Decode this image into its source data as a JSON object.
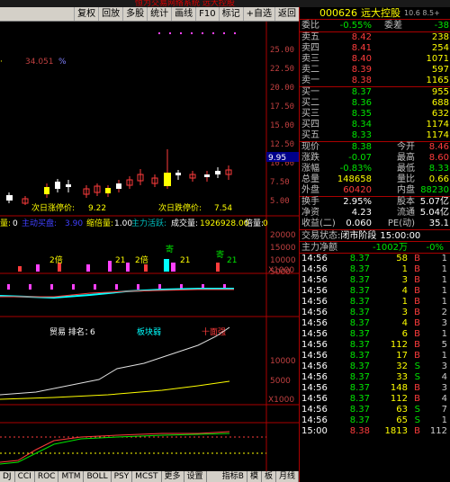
{
  "window_title": "恒为交易网络系统  远大控股",
  "toolbar": {
    "items": [
      "复权",
      "回放",
      "多股",
      "统计",
      "画线",
      "F10",
      "标记",
      "+自选",
      "返回"
    ]
  },
  "stock": {
    "code": "000626",
    "name": "远大控股"
  },
  "top_right_label": "10.6 8.5+",
  "axis_price": [
    "25.00",
    "22.50",
    "20.00",
    "17.50",
    "15.00",
    "12.50",
    "10.00",
    "7.50",
    "5.00"
  ],
  "current_price_tag": "9.95",
  "left_label_1": "34.051",
  "left_label_pct": "%",
  "limit_up_label": "次日涨停价:",
  "limit_up_value": "9.22",
  "limit_down_label": "次日跌停价:",
  "limit_down_value": "7.54",
  "volume_header": {
    "a": "量:",
    "a_val": "0",
    "b": "主动买盘:",
    "b_val": "3.90",
    "c": "缩倍量:",
    "c_val": "1.00",
    "d": "主力活跃:",
    "e": "成交量:",
    "e_val": "1926928.00",
    "f": "倍量:",
    "f_val": "0"
  },
  "vol_axis": [
    "20000",
    "15000",
    "10000",
    "5000",
    "X1000"
  ],
  "mark_labels": {
    "m1": "2倍",
    "m2": "2倍",
    "m3": "21",
    "m4": "寄",
    "m5": "21",
    "m6": "寄",
    "m7": "21"
  },
  "indicator3": {
    "rank_label": "贸易 排名：",
    "rank_val": "6",
    "weak_label": "板块弱",
    "strong_label": "十面强",
    "axis": [
      "10000",
      "5000",
      "X1000"
    ]
  },
  "tabs": [
    "DJ",
    "CCI",
    "ROC",
    "MTM",
    "BOLL",
    "PSY",
    "MCST",
    "更多",
    "设置"
  ],
  "tabs_right": [
    "指标B",
    "模",
    "板",
    "月线"
  ],
  "hq": {
    "weibi_label": "委比",
    "weibi_val": "-0.55%",
    "weicha_label": "委差",
    "weicha_val": "-38",
    "sell": [
      {
        "label": "卖五",
        "price": "8.42",
        "vol": "238"
      },
      {
        "label": "卖四",
        "price": "8.41",
        "vol": "254"
      },
      {
        "label": "卖三",
        "price": "8.40",
        "vol": "1071"
      },
      {
        "label": "卖二",
        "price": "8.39",
        "vol": "597"
      },
      {
        "label": "卖一",
        "price": "8.38",
        "vol": "1165"
      }
    ],
    "buy": [
      {
        "label": "买一",
        "price": "8.37",
        "vol": "955"
      },
      {
        "label": "买二",
        "price": "8.36",
        "vol": "688"
      },
      {
        "label": "买三",
        "price": "8.35",
        "vol": "632"
      },
      {
        "label": "买四",
        "price": "8.34",
        "vol": "1174"
      },
      {
        "label": "买五",
        "price": "8.33",
        "vol": "1174"
      }
    ],
    "stats": [
      {
        "l1": "现价",
        "v1": "8.38",
        "l2": "今开",
        "v2": "8.46",
        "c1": "grn",
        "c2": "red"
      },
      {
        "l1": "涨跌",
        "v1": "-0.07",
        "l2": "最高",
        "v2": "8.60",
        "c1": "grn",
        "c2": "red"
      },
      {
        "l1": "涨幅",
        "v1": "-0.83%",
        "l2": "最低",
        "v2": "8.33",
        "c1": "grn",
        "c2": "grn"
      },
      {
        "l1": "总量",
        "v1": "148658",
        "l2": "量比",
        "v2": "0.66",
        "c1": "yel",
        "c2": "yel"
      },
      {
        "l1": "外盘",
        "v1": "60420",
        "l2": "内盘",
        "v2": "88230",
        "c1": "red",
        "c2": "grn"
      }
    ],
    "stats2": [
      {
        "l1": "换手",
        "v1": "2.95%",
        "l2": "股本",
        "v2": "5.07亿"
      },
      {
        "l1": "净资",
        "v1": "4.23",
        "l2": "流通",
        "v2": "5.04亿"
      },
      {
        "l1": "收益(二)",
        "v1": "0.060",
        "l2": "PE(动)",
        "v2": "35.1"
      }
    ],
    "trade_status_label": "交易状态:",
    "trade_status": "闭市阶段",
    "trade_time": "15:00:00",
    "main_net_label": "主力净额",
    "main_net_val": "-1002万",
    "main_net_pct": "-0%",
    "ticks": [
      {
        "t": "14:56",
        "p": "8.37",
        "v": "58",
        "d": "B",
        "n": "1"
      },
      {
        "t": "14:56",
        "p": "8.37",
        "v": "1",
        "d": "B",
        "n": "1"
      },
      {
        "t": "14:56",
        "p": "8.37",
        "v": "3",
        "d": "B",
        "n": "1"
      },
      {
        "t": "14:56",
        "p": "8.37",
        "v": "4",
        "d": "B",
        "n": "1"
      },
      {
        "t": "14:56",
        "p": "8.37",
        "v": "1",
        "d": "B",
        "n": "1"
      },
      {
        "t": "14:56",
        "p": "8.37",
        "v": "3",
        "d": "B",
        "n": "2"
      },
      {
        "t": "14:56",
        "p": "8.37",
        "v": "4",
        "d": "B",
        "n": "3"
      },
      {
        "t": "14:56",
        "p": "8.37",
        "v": "6",
        "d": "B",
        "n": "1"
      },
      {
        "t": "14:56",
        "p": "8.37",
        "v": "112",
        "d": "B",
        "n": "5"
      },
      {
        "t": "14:56",
        "p": "8.37",
        "v": "17",
        "d": "B",
        "n": "1"
      },
      {
        "t": "14:56",
        "p": "8.37",
        "v": "32",
        "d": "S",
        "n": "3"
      },
      {
        "t": "14:56",
        "p": "8.37",
        "v": "33",
        "d": "S",
        "n": "4"
      },
      {
        "t": "14:56",
        "p": "8.37",
        "v": "148",
        "d": "B",
        "n": "3"
      },
      {
        "t": "14:56",
        "p": "8.37",
        "v": "112",
        "d": "B",
        "n": "4"
      },
      {
        "t": "14:56",
        "p": "8.37",
        "v": "63",
        "d": "S",
        "n": "7"
      },
      {
        "t": "14:56",
        "p": "8.37",
        "v": "65",
        "d": "S",
        "n": "1"
      },
      {
        "t": "15:00",
        "p": "8.38",
        "v": "1813",
        "d": "B",
        "n": "112"
      }
    ]
  }
}
